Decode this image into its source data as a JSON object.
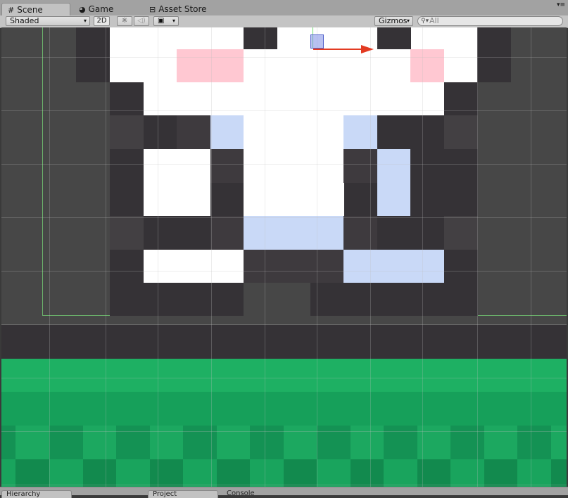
{
  "tabs": [
    {
      "label": "Scene",
      "icon": "grid-icon",
      "active": true
    },
    {
      "label": "Game",
      "icon": "pacman-icon",
      "active": false
    },
    {
      "label": "Asset Store",
      "icon": "store-icon",
      "active": false
    }
  ],
  "toolbar": {
    "shading_mode": "Shaded",
    "mode_2d": "2D",
    "gizmos": "Gizmos",
    "search_placeholder": "All"
  },
  "colors": {
    "scene_bg": "#474747",
    "dark_tile": "#353236",
    "white": "#ffffff",
    "pink": "#ffc8d2",
    "light_blue": "#c9d9f7",
    "grass_light": "#1eb063",
    "grass_mid": "#16a05a",
    "grass_dark": "#128a4e",
    "gizmo_x_axis": "#e33b22",
    "gizmo_y_axis": "#6fe06f",
    "gizmo_center": "#7d8ee6"
  },
  "bottom_tabs": [
    {
      "label": "Hierarchy"
    },
    {
      "label": "Project"
    },
    {
      "label": "Console"
    }
  ]
}
